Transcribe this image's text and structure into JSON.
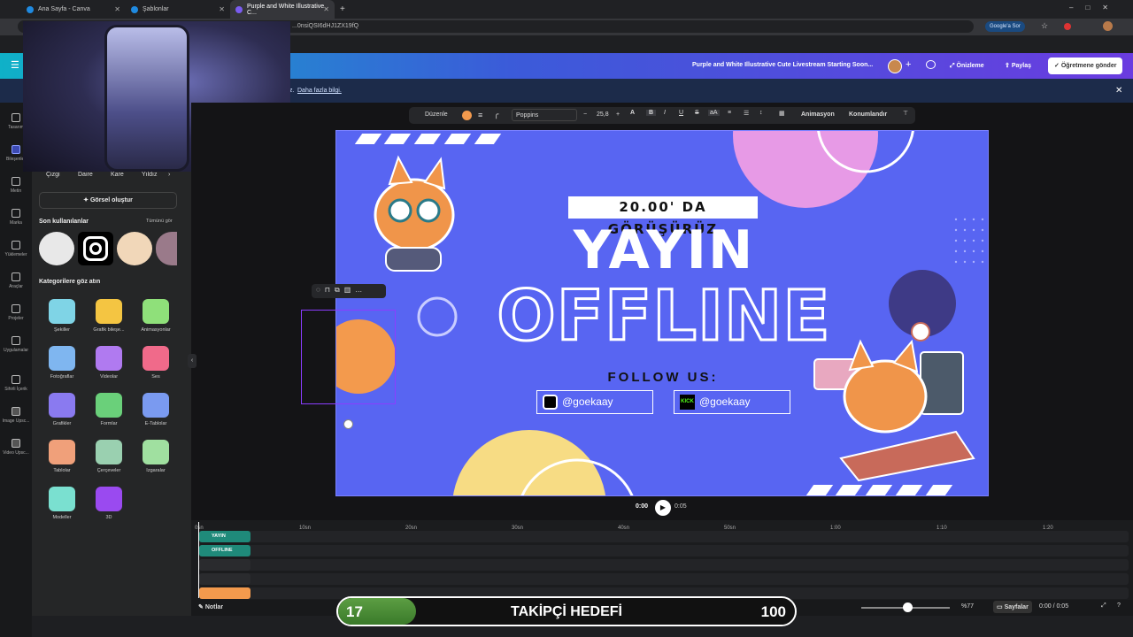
{
  "browser": {
    "tabs": [
      {
        "label": "Ana Sayfa - Canva"
      },
      {
        "label": "Şablonlar"
      },
      {
        "label": "Purple and White Illustrative C..."
      }
    ],
    "url": "...0nsiQSI6dHJ1ZX19fQ",
    "google_button": "Google'a Sor"
  },
  "header": {
    "doc_title": "Purple and White Illustrative Cute Livestream Starting Soon...",
    "preview": "Önizleme",
    "share": "Paylaş",
    "send_teacher": "Öğretmene gönder"
  },
  "banner": {
    "link": "Daha fazla bilgi.",
    "prefix": "z."
  },
  "rail": [
    {
      "label": "Tasarım"
    },
    {
      "label": "Bileşenler"
    },
    {
      "label": "Metin"
    },
    {
      "label": "Marka"
    },
    {
      "label": "Yüklemeler"
    },
    {
      "label": "Araçlar"
    },
    {
      "label": "Projeler"
    },
    {
      "label": "Uygulamalar"
    },
    {
      "label": "Sihirli İçerik"
    },
    {
      "label": "Image Upsc..."
    },
    {
      "label": "Video Upsc..."
    }
  ],
  "panel": {
    "chips": [
      "Çizgi",
      "Daire",
      "Kare",
      "Yıldız"
    ],
    "create_visual": "Görsel oluştur",
    "recent_title": "Son kullanılanlar",
    "see_all": "Tümünü gör",
    "categories_title": "Kategorilere göz atın",
    "categories": [
      {
        "label": "Şekiller",
        "color": "#7fd4e6"
      },
      {
        "label": "Grafik bileşe...",
        "color": "#f4c542"
      },
      {
        "label": "Animasyonlar",
        "color": "#8fe07a"
      },
      {
        "label": "Fotoğraflar",
        "color": "#7fb6f0"
      },
      {
        "label": "Videolar",
        "color": "#b07af0"
      },
      {
        "label": "Ses",
        "color": "#f06a8a"
      },
      {
        "label": "Grafikler",
        "color": "#8a7af0"
      },
      {
        "label": "Formlar",
        "color": "#6ad07a"
      },
      {
        "label": "E-Tablolar",
        "color": "#7a9af0"
      },
      {
        "label": "Tablolar",
        "color": "#f0a07a"
      },
      {
        "label": "Çerçeveler",
        "color": "#9ad0b0"
      },
      {
        "label": "Izgaralar",
        "color": "#a0e0a0"
      },
      {
        "label": "Modeller",
        "color": "#7ae0d0"
      },
      {
        "label": "3D",
        "color": "#9a4af0"
      }
    ]
  },
  "toolbar": {
    "edit": "Düzenle",
    "font": "Poppins",
    "font_size": "25,8",
    "animate": "Animasyon",
    "position": "Konumlandır",
    "minus": "−",
    "plus": "+"
  },
  "design": {
    "subtitle": "20.00' DA GÖRÜŞÜRÜZ",
    "title1": "YAYIN",
    "title2": "OFFLINE",
    "follow": "FOLLOW US:",
    "handles": [
      {
        "platform": "instagram",
        "text": "@goekaay"
      },
      {
        "platform": "kick",
        "text": "@goekaay"
      }
    ],
    "colors": {
      "background": "#5865f2",
      "accent_pink": "#e79ae6",
      "accent_orange": "#f39a4d",
      "accent_yellow": "#f7dc84",
      "accent_navy": "#3e3a86"
    }
  },
  "player": {
    "current": "0:00",
    "total": "0:05"
  },
  "timeline": {
    "ruler": [
      "0sn",
      "10sn",
      "20sn",
      "30sn",
      "40sn",
      "50sn",
      "1:00",
      "1:10",
      "1:20"
    ],
    "tracks": [
      {
        "label": "YAYIN",
        "color": "#1f8a7a"
      },
      {
        "label": "OFFLINE",
        "color": "#1f8a7a"
      },
      {
        "label": "",
        "color": "#2a2b2e"
      },
      {
        "label": "",
        "color": "#2a2b2e"
      },
      {
        "label": "",
        "color": "#f39a4d"
      }
    ]
  },
  "bottom": {
    "notes": "Notlar",
    "zoom": "%77",
    "pages": "Sayfalar",
    "time": "0:00 / 0:05"
  },
  "goal": {
    "current": "17",
    "label": "TAKİPÇİ HEDEFİ",
    "target": "100",
    "progress": 0.17
  }
}
